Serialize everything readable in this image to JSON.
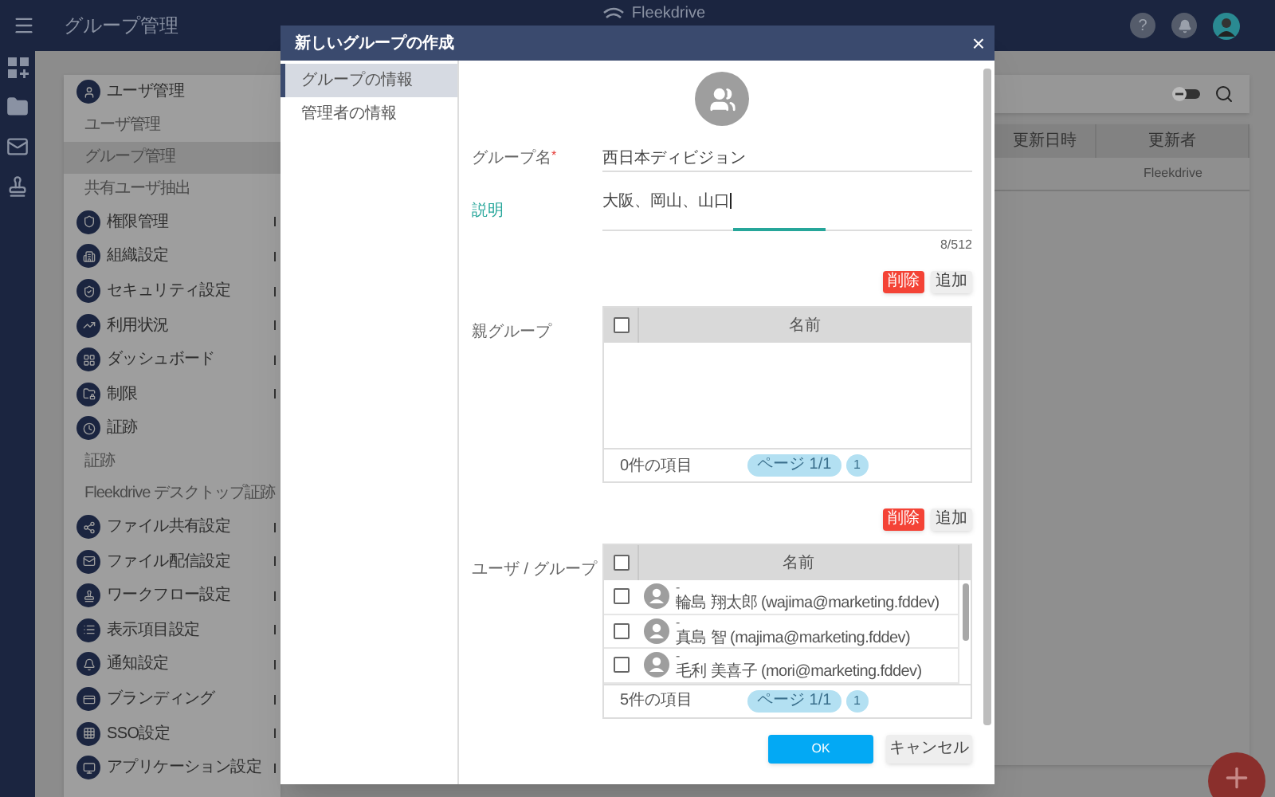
{
  "header": {
    "title": "グループ管理",
    "logo": "Fleekdrive",
    "help": "?"
  },
  "settings_menu": [
    {
      "label": "ユーザ管理",
      "kind": "section",
      "expandable": false,
      "selected": false
    },
    {
      "label": "ユーザ管理",
      "kind": "sub",
      "selected": false
    },
    {
      "label": "グループ管理",
      "kind": "sub",
      "selected": true
    },
    {
      "label": "共有ユーザ抽出",
      "kind": "sub",
      "selected": false
    },
    {
      "label": "権限管理",
      "kind": "section",
      "expandable": true,
      "selected": false
    },
    {
      "label": "組織設定",
      "kind": "section",
      "expandable": true,
      "selected": false
    },
    {
      "label": "セキュリティ設定",
      "kind": "section",
      "expandable": true,
      "selected": false
    },
    {
      "label": "利用状況",
      "kind": "section",
      "expandable": true,
      "selected": false
    },
    {
      "label": "ダッシュボード",
      "kind": "section",
      "expandable": true,
      "selected": false
    },
    {
      "label": "制限",
      "kind": "section",
      "expandable": true,
      "selected": false
    },
    {
      "label": "証跡",
      "kind": "section",
      "expandable": false,
      "selected": false
    },
    {
      "label": "証跡",
      "kind": "sub",
      "selected": false
    },
    {
      "label": "Fleekdrive デスクトップ証跡",
      "kind": "sub",
      "selected": false
    },
    {
      "label": "ファイル共有設定",
      "kind": "section",
      "expandable": true,
      "selected": false
    },
    {
      "label": "ファイル配信設定",
      "kind": "section",
      "expandable": true,
      "selected": false
    },
    {
      "label": "ワークフロー設定",
      "kind": "section",
      "expandable": true,
      "selected": false
    },
    {
      "label": "表示項目設定",
      "kind": "section",
      "expandable": true,
      "selected": false
    },
    {
      "label": "通知設定",
      "kind": "section",
      "expandable": true,
      "selected": false
    },
    {
      "label": "ブランディング",
      "kind": "section",
      "expandable": true,
      "selected": false
    },
    {
      "label": "SSO設定",
      "kind": "section",
      "expandable": true,
      "selected": false
    },
    {
      "label": "アプリケーション設定",
      "kind": "section",
      "expandable": true,
      "selected": false
    }
  ],
  "list_view": {
    "columns": [
      "更新日時",
      "更新者"
    ],
    "rows": [
      {
        "updated_by": "Fleekdrive"
      }
    ]
  },
  "modal": {
    "title": "新しいグループの作成",
    "close": "×",
    "nav": [
      {
        "label": "グループの情報",
        "selected": true
      },
      {
        "label": "管理者の情報",
        "selected": false
      }
    ],
    "group_name": {
      "label": "グループ名",
      "required_mark": "*",
      "value": "西日本ディビジョン"
    },
    "description": {
      "label": "説明",
      "focused": true,
      "value": "大阪、岡山、山口",
      "counter": "8/512"
    },
    "parent_group": {
      "label": "親グループ",
      "delete": "削除",
      "add": "追加",
      "column": "名前",
      "all_checked": false,
      "count": "0件の項目",
      "page": "ページ 1/1",
      "page_number": "1"
    },
    "members": {
      "label": "ユーザ / グループ",
      "delete": "削除",
      "add": "追加",
      "column": "名前",
      "all_checked": false,
      "rows": [
        {
          "note": "-",
          "name": "輪島 翔太郎 (wajima@marketing.fddev)",
          "checked": false
        },
        {
          "note": "-",
          "name": "真島 智 (majima@marketing.fddev)",
          "checked": false
        },
        {
          "note": "-",
          "name": "毛利 美喜子 (mori@marketing.fddev)",
          "checked": false
        }
      ],
      "count": "5件の項目",
      "page": "ページ 1/1",
      "page_number": "1"
    },
    "ok": "OK",
    "cancel": "キャンセル"
  }
}
